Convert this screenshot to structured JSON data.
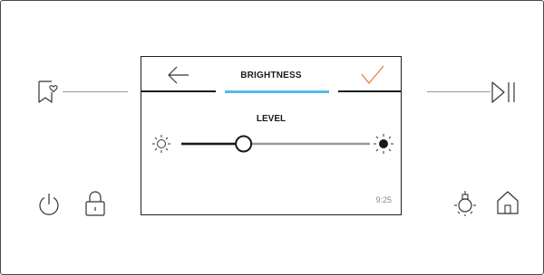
{
  "screen": {
    "title": "BRIGHTNESS",
    "level_label": "LEVEL",
    "clock": "9:25",
    "back_icon": "arrow-left-icon",
    "confirm_icon": "checkmark-icon"
  },
  "brightness": {
    "level": 0.33,
    "min_icon": "sun-low-icon",
    "max_icon": "sun-high-icon"
  },
  "side_controls": {
    "favorite_icon": "bookmark-heart-icon",
    "play_pause_icon": "play-pause-icon",
    "power_icon": "power-icon",
    "lock_icon": "lock-icon",
    "lamp_icon": "lamp-icon",
    "home_icon": "home-icon"
  },
  "colors": {
    "accent": "#f07a3a",
    "tab_highlight": "#5bb8e8",
    "line": "#9a9a9a",
    "slider_active": "#1a1a1a",
    "slider_inactive": "#9a9a9a"
  }
}
